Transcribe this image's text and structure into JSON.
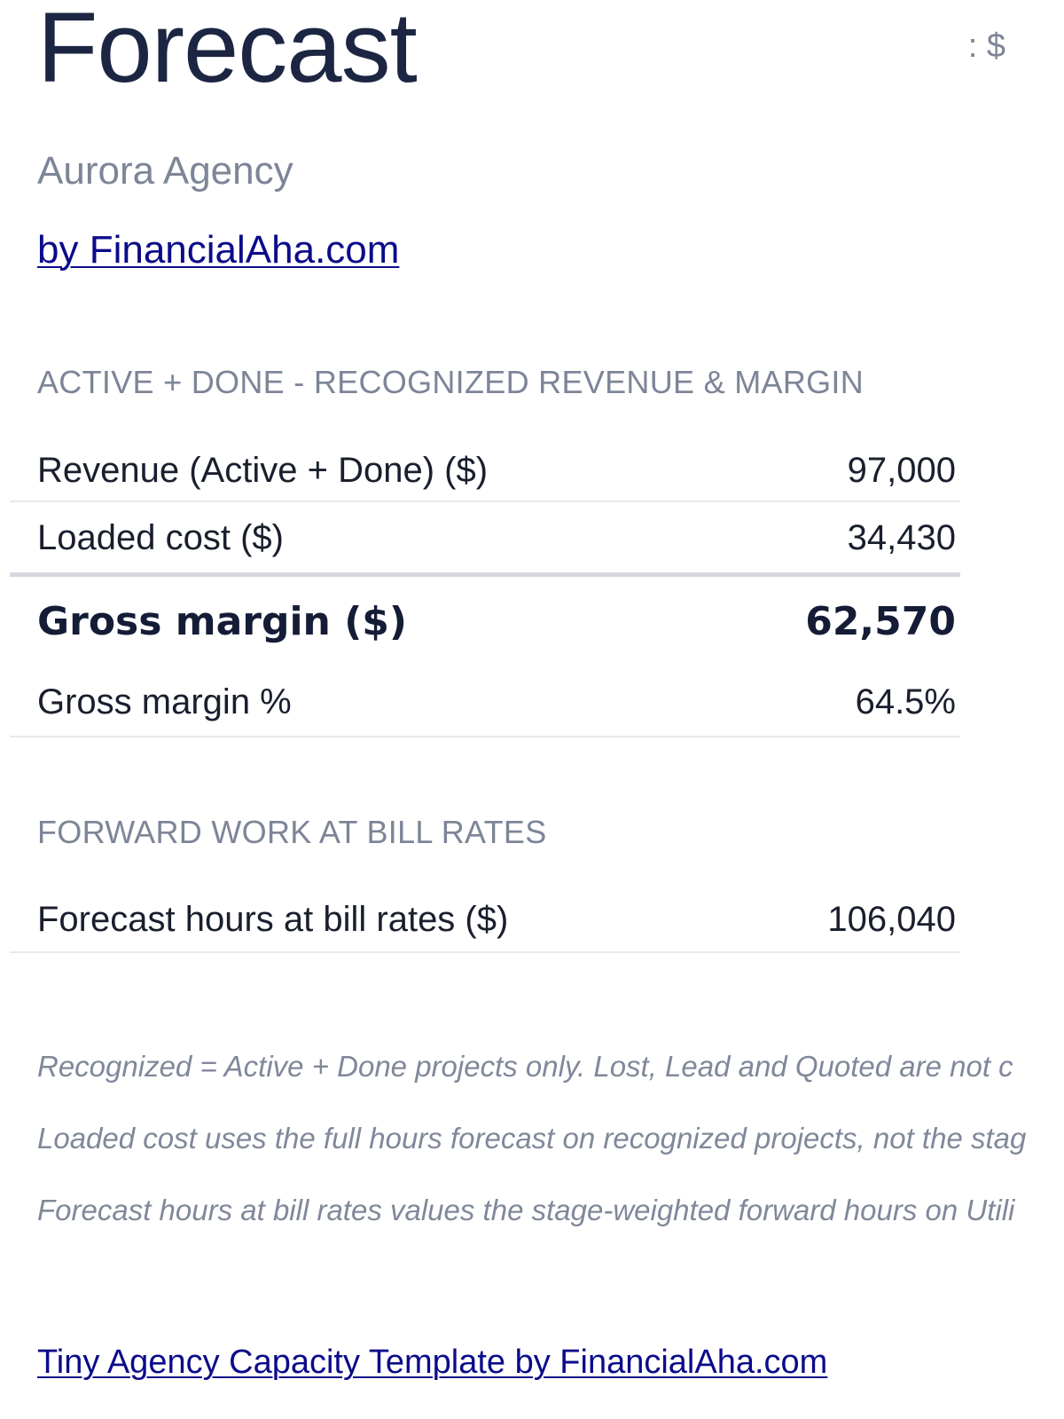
{
  "header": {
    "title": "Forecast",
    "currency_label": ": $",
    "company": "Aurora Agency",
    "by_link": "by FinancialAha.com"
  },
  "recognized": {
    "heading": "ACTIVE + DONE - RECOGNIZED REVENUE & MARGIN",
    "rows": [
      {
        "label": "Revenue (Active + Done) ($)",
        "value": "97,000"
      },
      {
        "label": "Loaded cost ($)",
        "value": "34,430"
      },
      {
        "label": "Gross margin ($)",
        "value": "62,570"
      },
      {
        "label": "Gross margin %",
        "value": "64.5%"
      }
    ]
  },
  "forward": {
    "heading": "FORWARD WORK AT BILL RATES",
    "rows": [
      {
        "label": "Forecast hours at bill rates ($)",
        "value": "106,040"
      }
    ]
  },
  "notes": [
    "Recognized = Active + Done projects only. Lost, Lead and Quoted are not c",
    "Loaded cost uses the full hours forecast on recognized projects, not the stag",
    "Forecast hours at bill rates values the stage-weighted forward hours on Utili"
  ],
  "footer": {
    "link": "Tiny Agency Capacity Template by FinancialAha.com"
  }
}
